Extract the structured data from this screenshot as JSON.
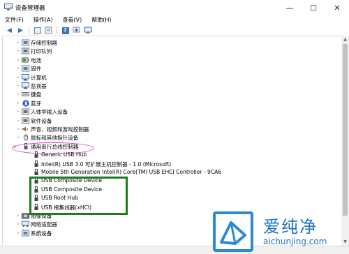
{
  "window": {
    "title": "设备管理器",
    "controls": {
      "minimize": "—",
      "maximize": "☐",
      "close": "✕"
    }
  },
  "menubar": {
    "items": [
      "文件(F)",
      "操作(A)",
      "查看(V)",
      "帮助(H)"
    ]
  },
  "toolbar": {
    "back_icon": "◀",
    "forward_icon": "▶",
    "help_glyph": "?"
  },
  "tree": {
    "categories_top": [
      {
        "label": "存储控制器",
        "icon": "storage-controller-icon"
      },
      {
        "label": "打印队列",
        "icon": "print-queue-icon"
      },
      {
        "label": "电池",
        "icon": "battery-icon"
      },
      {
        "label": "固件",
        "icon": "firmware-icon"
      },
      {
        "label": "计算机",
        "icon": "computer-icon"
      },
      {
        "label": "监视器",
        "icon": "monitor-icon"
      },
      {
        "label": "键盘",
        "icon": "keyboard-icon"
      },
      {
        "label": "蓝牙",
        "icon": "bluetooth-icon"
      },
      {
        "label": "人体学输入设备",
        "icon": "hid-icon"
      },
      {
        "label": "软件设备",
        "icon": "software-device-icon"
      },
      {
        "label": "声音、视频和游戏控制器",
        "icon": "sound-icon"
      },
      {
        "label": "鼠标和其他指针设备",
        "icon": "mouse-icon"
      }
    ],
    "expanded": {
      "label": "通用串行总线控制器",
      "children": [
        "Generic USB Hub",
        "Intel(R) USB 3.0 可扩展主机控制器 - 1.0 (Microsoft)",
        "Mobile 5th Generation Intel(R) Core(TM) USB EHCI Controller - 9CA6",
        "USB Composite Device",
        "USB Composite Device",
        "USB Root Hub",
        "USB 根集线器(xHCI)"
      ]
    },
    "categories_bottom": [
      {
        "label": "图像设备",
        "icon": "imaging-device-icon"
      },
      {
        "label": "网络适配器",
        "icon": "network-adapter-icon"
      },
      {
        "label": "系统设备",
        "icon": "system-device-icon"
      }
    ]
  },
  "watermark": {
    "title": "爱纯净",
    "url": "aichunjing.com"
  },
  "colors": {
    "ellipse": "#e23bd8",
    "box": "#1f7a1f",
    "watermark": "#1a74c8"
  }
}
